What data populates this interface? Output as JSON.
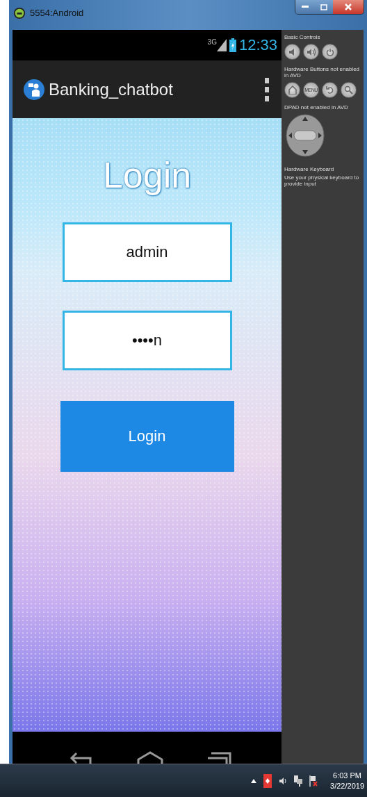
{
  "window": {
    "title": "5554:Android"
  },
  "status_bar": {
    "network": "3G",
    "time": "12:33"
  },
  "app_bar": {
    "title": "Banking_chatbot"
  },
  "login": {
    "heading": "Login",
    "username": "admin",
    "password": "••••n",
    "button": "Login"
  },
  "controls_panel": {
    "basic_label": "Basic Controls",
    "hardware_label": "Hardware Buttons not enabled in AVD",
    "menu_key": "MENU",
    "dpad_label": "DPAD not enabled in AVD",
    "keyboard_title": "Hardware Keyboard",
    "keyboard_hint": "Use your physical keyboard to provide input"
  },
  "taskbar": {
    "time": "6:03 PM",
    "date": "3/22/2019"
  }
}
